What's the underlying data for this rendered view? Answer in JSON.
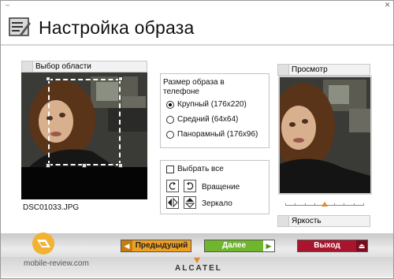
{
  "window": {
    "close_glyph": "✕",
    "minimize_glyph": "–"
  },
  "header": {
    "title": "Настройка образа",
    "icon": "settings-tool-icon"
  },
  "area_panel": {
    "label": "Выбор области",
    "filename": "DSC01033.JPG"
  },
  "size_panel": {
    "label": "Размер образа в телефоне",
    "options": [
      {
        "label": "Крупный (176x220)",
        "selected": true
      },
      {
        "label": "Средний (64x64)",
        "selected": false
      },
      {
        "label": "Панорамный (176x96)",
        "selected": false
      }
    ]
  },
  "tools_panel": {
    "select_all": "Выбрать все",
    "rotate": "Вращение",
    "mirror": "Зеркало"
  },
  "preview_panel": {
    "label": "Просмотр",
    "brightness_label": "Яркость",
    "brightness_level": 0.5
  },
  "nav": {
    "prev": "Предыдущий",
    "next": "Далее",
    "exit": "Выход",
    "prev_color": "#f0a020",
    "next_color": "#6fb62c",
    "exit_color": "#a8152c"
  },
  "branding": {
    "site": "mobile-review.com",
    "brand": "ALCATEL"
  }
}
